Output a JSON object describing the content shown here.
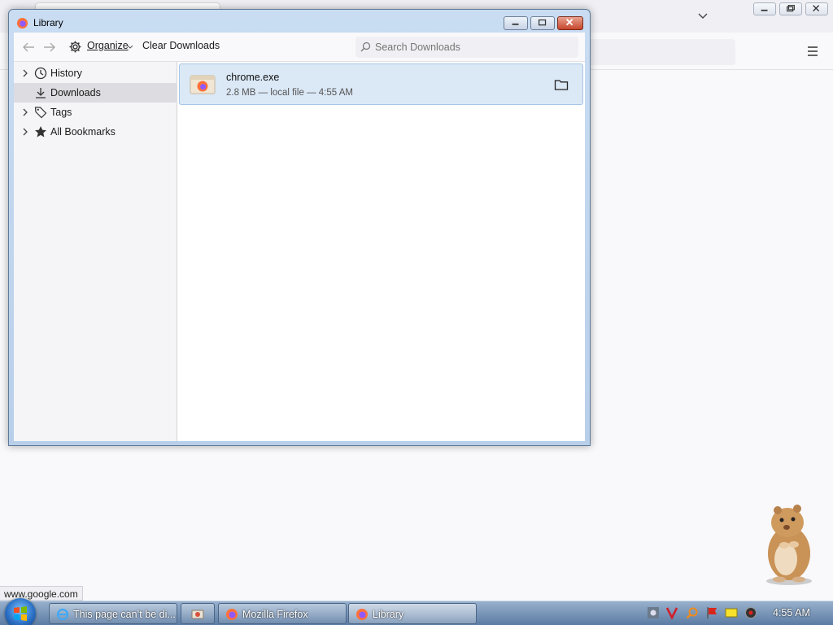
{
  "library": {
    "title": "Library",
    "toolbar": {
      "organize_label": "Organize",
      "clear_label": "Clear Downloads",
      "search_placeholder": "Search Downloads"
    },
    "sidebar": {
      "items": [
        {
          "label": "History",
          "icon": "clock-icon",
          "expandable": true
        },
        {
          "label": "Downloads",
          "icon": "download-icon",
          "expandable": false,
          "selected": true
        },
        {
          "label": "Tags",
          "icon": "tag-icon",
          "expandable": true
        },
        {
          "label": "All Bookmarks",
          "icon": "star-icon",
          "expandable": true
        }
      ]
    },
    "downloads": [
      {
        "name": "chrome.exe",
        "meta": "2.8 MB — local file — 4:55 AM"
      }
    ]
  },
  "browser": {
    "status_url": "www.google.com"
  },
  "taskbar": {
    "items": [
      {
        "label": "This page can’t be di...",
        "icon": "ie-icon"
      },
      {
        "label": "",
        "icon": "app-icon"
      },
      {
        "label": "Mozilla Firefox",
        "icon": "firefox-icon"
      },
      {
        "label": "Library",
        "icon": "firefox-icon"
      }
    ],
    "clock": "4:55 AM"
  }
}
